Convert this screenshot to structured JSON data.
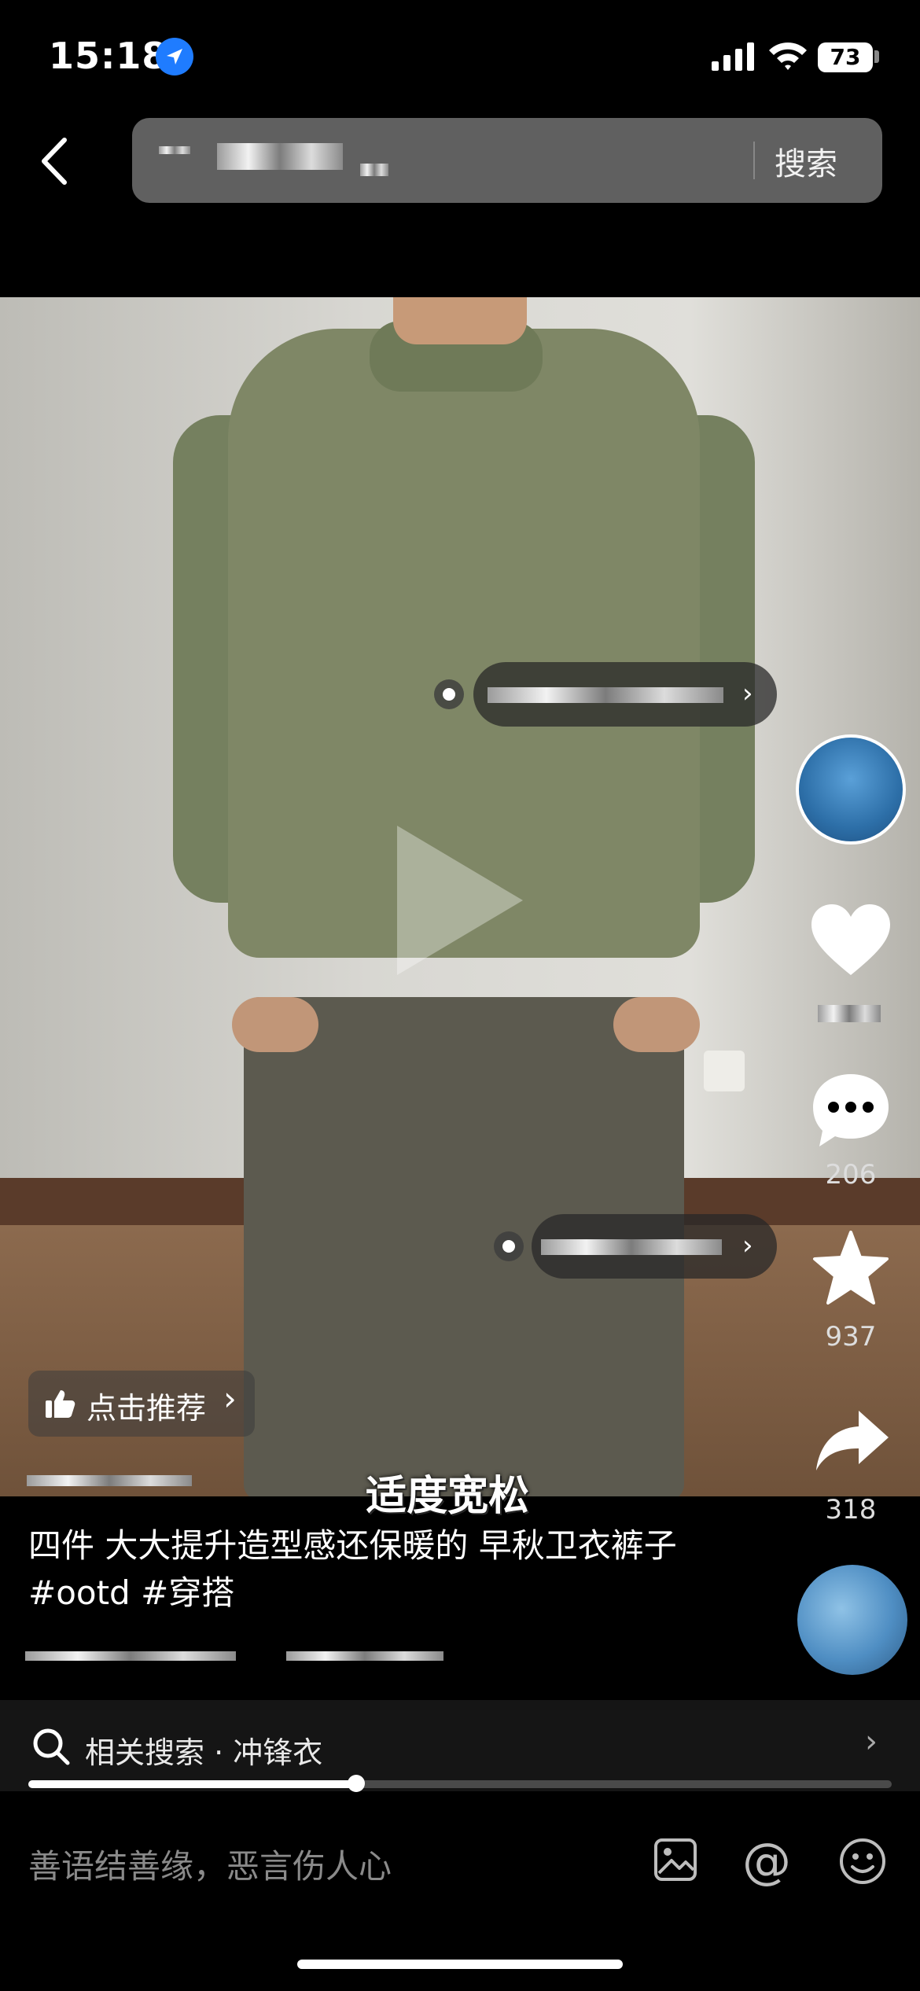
{
  "status_bar": {
    "time": "15:18",
    "battery": "73"
  },
  "header": {
    "search_button": "搜索"
  },
  "video": {
    "subtitle": "适度宽松",
    "recommend_label": "点击推荐",
    "recommend_chevron": "›"
  },
  "actions": {
    "comments": "206",
    "favorites": "937",
    "shares": "318"
  },
  "caption": {
    "text": "四件 大大提升造型感还保暖的 早秋卫衣裤子#ootd #穿搭"
  },
  "related_search": {
    "label": "相关搜索 · 冲锋衣",
    "chevron": "›",
    "progress": 0.38
  },
  "comment_bar": {
    "placeholder": "善语结善缘，恶言伤人心"
  },
  "icons": [
    "location-icon",
    "signal-icon",
    "wifi-icon",
    "back-icon",
    "play-icon",
    "thumbs-up-icon",
    "heart-icon",
    "comment-icon",
    "star-icon",
    "share-icon",
    "search-icon",
    "image-icon",
    "at-icon",
    "emoji-icon"
  ]
}
